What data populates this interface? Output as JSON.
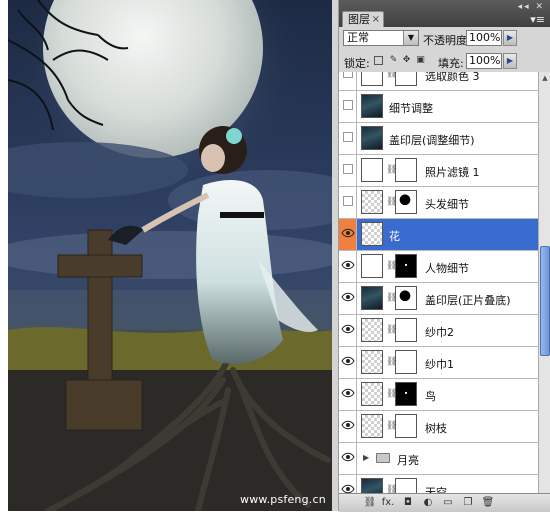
{
  "canvas": {
    "watermark": "www.psfeng.cn"
  },
  "panel": {
    "tab_label": "图层",
    "tab_close": "×",
    "window_buttons": "◂◂ ✕",
    "menu_icon": "▾≡",
    "blend_mode": "正常",
    "opacity_label": "不透明度:",
    "opacity_value": "100%",
    "lock_label": "锁定:",
    "fill_label": "填充:",
    "fill_value": "100%",
    "layers": [
      {
        "name": "选取颜色 3",
        "visible": false,
        "thumb": "adj",
        "mask": "white",
        "selected": false
      },
      {
        "name": "细节调整",
        "visible": false,
        "thumb": "photo",
        "mask": null,
        "selected": false
      },
      {
        "name": "盖印层(调整细节)",
        "visible": false,
        "thumb": "photo",
        "mask": null,
        "selected": false
      },
      {
        "name": "照片滤镜 1",
        "visible": false,
        "thumb": "adj",
        "mask": "white",
        "selected": false
      },
      {
        "name": "头发细节",
        "visible": false,
        "thumb": "checker",
        "mask": "shape",
        "selected": false
      },
      {
        "name": "花",
        "visible": true,
        "thumb": "checker",
        "mask": null,
        "selected": true
      },
      {
        "name": "人物细节",
        "visible": true,
        "thumb": "adj",
        "mask": "black",
        "selected": false
      },
      {
        "name": "盖印层(正片叠底)",
        "visible": true,
        "thumb": "photo",
        "mask": "shape",
        "selected": false
      },
      {
        "name": "纱巾2",
        "visible": true,
        "thumb": "checker",
        "mask": "white",
        "selected": false
      },
      {
        "name": "纱巾1",
        "visible": true,
        "thumb": "checker",
        "mask": "white",
        "selected": false
      },
      {
        "name": "鸟",
        "visible": true,
        "thumb": "checker",
        "mask": "black",
        "selected": false
      },
      {
        "name": "树枝",
        "visible": true,
        "thumb": "checker",
        "mask": "white",
        "selected": false
      },
      {
        "name": "月亮",
        "visible": true,
        "thumb": "folder",
        "mask": null,
        "selected": false
      },
      {
        "name": "天空",
        "visible": true,
        "thumb": "photo",
        "mask": "white",
        "selected": false
      }
    ],
    "bottom_icons": [
      "link-icon",
      "fx-icon",
      "mask-icon",
      "adjustment-icon",
      "folder-icon",
      "new-layer-icon",
      "trash-icon"
    ],
    "bottom_glyphs": [
      "⛓",
      "fx.",
      "◘",
      "◐",
      "▭",
      "❐",
      "🗑"
    ]
  },
  "colors": {
    "selection": "#3a6ccf",
    "eye_highlight": "#f08040"
  }
}
